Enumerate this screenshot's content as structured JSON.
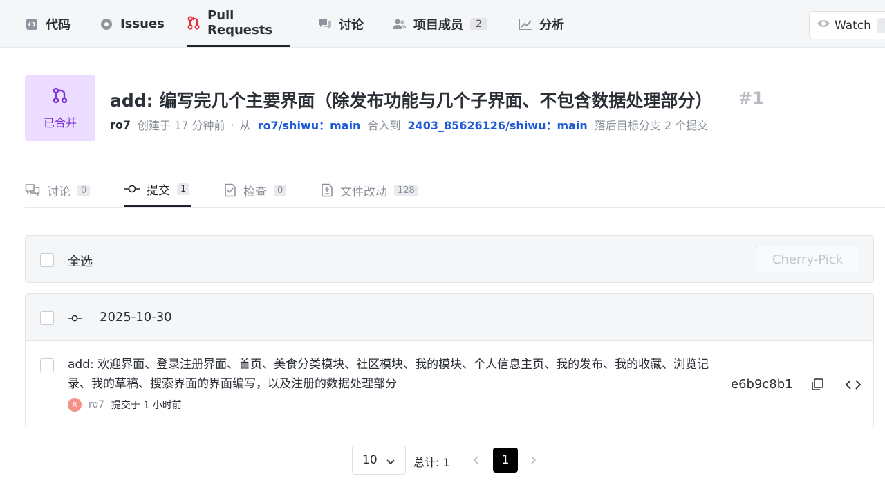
{
  "nav": {
    "items": [
      {
        "label": "代码",
        "icon": "code-icon"
      },
      {
        "label": "Issues",
        "icon": "issues-icon"
      },
      {
        "label": "Pull Requests",
        "icon": "pull-request-icon"
      },
      {
        "label": "讨论",
        "icon": "discussion-icon"
      },
      {
        "label": "项目成员",
        "icon": "members-icon",
        "count": "2"
      },
      {
        "label": "分析",
        "icon": "analytics-icon"
      }
    ],
    "active": "Pull Requests",
    "watch_label": "Watch"
  },
  "pr": {
    "status": "已合并",
    "title": "add: 编写完几个主要界面（除发布功能与几个子界面、不包含数据处理部分）",
    "number": "#1",
    "author": "ro7",
    "created": "创建于 17 分钟前",
    "dot": "·",
    "from_label": "从",
    "source_branch": "ro7/shiwu：main",
    "into_label": "合入到",
    "target_branch": "2403_85626126/shiwu：main",
    "behind": "落后目标分支 2 个提交"
  },
  "tabs": [
    {
      "label": "讨论",
      "count": "0",
      "icon": "discussion-icon"
    },
    {
      "label": "提交",
      "count": "1",
      "icon": "commit-icon"
    },
    {
      "label": "检查",
      "count": "0",
      "icon": "check-icon"
    },
    {
      "label": "文件改动",
      "count": "128",
      "icon": "file-diff-icon"
    }
  ],
  "active_tab": "提交",
  "commits": {
    "select_all": "全选",
    "cherry_pick": "Cherry-Pick",
    "group_date": "2025-10-30",
    "items": [
      {
        "message": "add: 欢迎界面、登录注册界面、首页、美食分类模块、社区模块、我的模块、个人信息主页、我的发布、我的收藏、浏览记录、我的草稿、搜索界面的界面编写，以及注册的数据处理部分",
        "avatar_letter": "R",
        "author": "ro7",
        "time": "提交于 1 小时前",
        "sha": "e6b9c8b1"
      }
    ]
  },
  "pagination": {
    "page_size": "10",
    "total": "总计: 1",
    "current": "1"
  },
  "colors": {
    "merged_bg": "#ecdcff",
    "merged_fg": "#7b34d6",
    "branch_link": "#1d5bd6",
    "pr_icon_red": "#e0313a"
  }
}
